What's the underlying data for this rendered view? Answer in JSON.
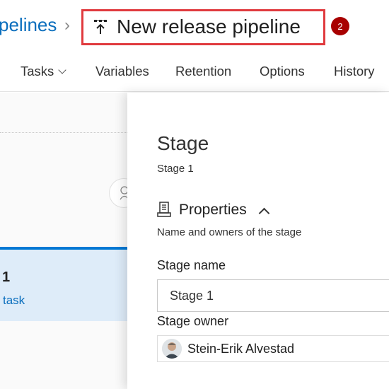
{
  "breadcrumb": {
    "parent_label": "pelines",
    "separator": "›"
  },
  "header": {
    "title": "New release pipeline",
    "title_icon": "pipeline-icon",
    "notification_badge": "2",
    "highlight_color": "#e03a3e"
  },
  "tabs": [
    {
      "label": "Tasks",
      "has_dropdown": true
    },
    {
      "label": "Variables"
    },
    {
      "label": "Retention"
    },
    {
      "label": "Options"
    },
    {
      "label": "History"
    }
  ],
  "canvas": {
    "stage_card": {
      "name": "1",
      "task_text": "task"
    },
    "assign_icon": "person-icon"
  },
  "panel": {
    "heading": "Stage",
    "subheading": "Stage 1",
    "section": {
      "icon": "properties-icon",
      "title": "Properties",
      "description": "Name and owners of the stage"
    },
    "stage_name_label": "Stage name",
    "stage_name_value": "Stage 1",
    "stage_owner_label": "Stage owner",
    "stage_owner_name": "Stein-Erik Alvestad"
  },
  "colors": {
    "accent": "#0078d4",
    "link": "#0a6ebd",
    "badge": "#a80000",
    "card_background": "#deecf9"
  }
}
